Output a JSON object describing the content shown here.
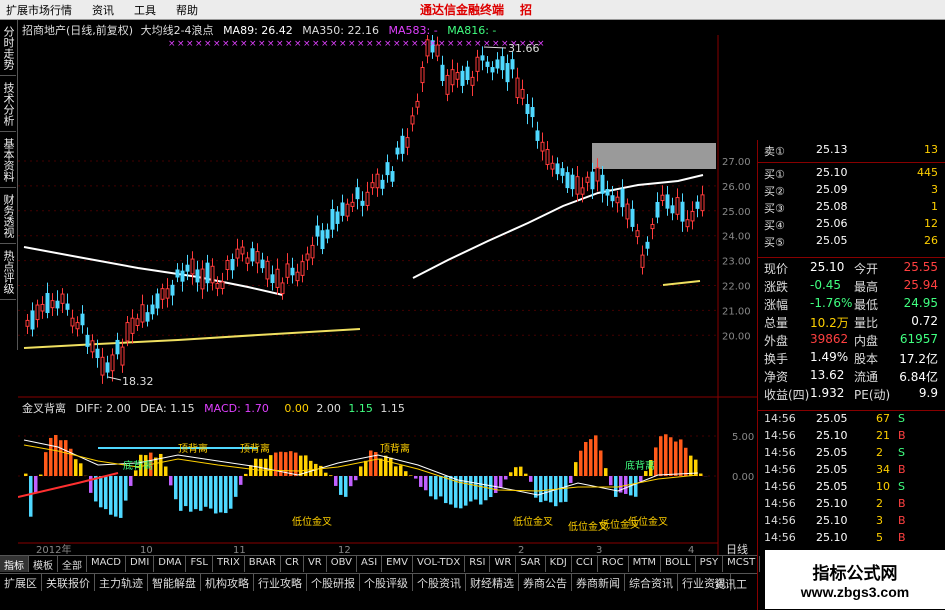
{
  "menu": {
    "items": [
      "扩展市场行情",
      "资讯",
      "工具",
      "帮助"
    ],
    "promo": "通达信金融终端",
    "promo2": "招"
  },
  "left_tabs": [
    "分时走势",
    "技术分析",
    "基本资料",
    "财务透视",
    "热点评级"
  ],
  "chart_title": {
    "name": "招商地产(日线,前复权)",
    "indicator": "大均线2-4浪点",
    "ma89": "MA89: 26.42",
    "ma350": "MA350: 22.16",
    "ma583": "MA583: -",
    "ma816": "MA816: -"
  },
  "price_labels": {
    "high": "31.66",
    "low": "18.32"
  },
  "price_axis": [
    "27.00",
    "26.00",
    "25.00",
    "24.00",
    "23.00",
    "22.00",
    "21.00",
    "20.00"
  ],
  "macd_title": {
    "name": "金叉背离",
    "diff": "DIFF: 2.00",
    "dea": "DEA: 1.15",
    "macd": "MACD: 1.70",
    "v1": "0.00",
    "v2": "2.00",
    "v3": "1.15",
    "v4": "1.15"
  },
  "macd_axis": [
    "5.00",
    "0.00"
  ],
  "annotations": [
    "顶背离",
    "顶背离",
    "顶背离",
    "低位金叉",
    "低位金叉",
    "低位金叉",
    "低位金叉",
    "低位金叉",
    "底背离",
    "底背离"
  ],
  "date_labels": [
    "2012年",
    "10",
    "11",
    "12",
    "2",
    "3",
    "4"
  ],
  "order_book": {
    "sells": [
      {
        "label": "卖①",
        "price": "25.13",
        "vol": "13"
      }
    ],
    "buys": [
      {
        "label": "买①",
        "price": "25.10",
        "vol": "445"
      },
      {
        "label": "买②",
        "price": "25.09",
        "vol": "3"
      },
      {
        "label": "买③",
        "price": "25.08",
        "vol": "1"
      },
      {
        "label": "买④",
        "price": "25.06",
        "vol": "12"
      },
      {
        "label": "买⑤",
        "price": "25.05",
        "vol": "26"
      }
    ]
  },
  "quote": [
    {
      "l": "现价",
      "v": "25.10",
      "l2": "今开",
      "v2": "25.55"
    },
    {
      "l": "涨跌",
      "v": "-0.45",
      "l2": "最高",
      "v2": "25.94"
    },
    {
      "l": "涨幅",
      "v": "-1.76%",
      "l2": "最低",
      "v2": "24.95"
    },
    {
      "l": "总量",
      "v": "10.2万",
      "l2": "量比",
      "v2": "0.72"
    },
    {
      "l": "外盘",
      "v": "39862",
      "l2": "内盘",
      "v2": "61957"
    },
    {
      "l": "换手",
      "v": "1.49%",
      "l2": "股本",
      "v2": "17.2亿"
    },
    {
      "l": "净资",
      "v": "13.62",
      "l2": "流通",
      "v2": "6.84亿"
    },
    {
      "l": "收益(四)",
      "v": "1.932",
      "l2": "PE(动)",
      "v2": "9.9"
    }
  ],
  "ticks": [
    {
      "t": "14:56",
      "p": "25.05",
      "v": "67",
      "s": "S"
    },
    {
      "t": "14:56",
      "p": "25.10",
      "v": "21",
      "s": "B"
    },
    {
      "t": "14:56",
      "p": "25.05",
      "v": "2",
      "s": "S"
    },
    {
      "t": "14:56",
      "p": "25.05",
      "v": "34",
      "s": "B"
    },
    {
      "t": "14:56",
      "p": "25.05",
      "v": "10",
      "s": "S"
    },
    {
      "t": "14:56",
      "p": "25.10",
      "v": "2",
      "s": "B"
    },
    {
      "t": "14:56",
      "p": "25.10",
      "v": "3",
      "s": "B"
    },
    {
      "t": "14:56",
      "p": "25.10",
      "v": "5",
      "s": "B"
    }
  ],
  "indicator_tabs": [
    "指标",
    "模板",
    "全部",
    "MACD",
    "DMI",
    "DMA",
    "FSL",
    "TRIX",
    "BRAR",
    "CR",
    "VR",
    "OBV",
    "ASI",
    "EMV",
    "VOL-TDX",
    "RSI",
    "WR",
    "SAR",
    "KDJ",
    "CCI",
    "ROC",
    "MTM",
    "BOLL",
    "PSY",
    "MCST"
  ],
  "bottom_tabs": [
    "扩展区",
    "关联报价",
    "主力轨迹",
    "智能解盘",
    "机构攻略",
    "行业攻略",
    "个股研报",
    "个股评级",
    "个股资讯",
    "财经精选",
    "券商公告",
    "券商新闻",
    "综合资讯",
    "行业资讯"
  ],
  "right_bottom": {
    "tab1": "日线",
    "tab2": "资讯工"
  },
  "watermark": {
    "line1": "指标公式网",
    "line2": "www.zbgs3.com"
  },
  "colors": {
    "up": "#ff3b3b",
    "down": "#4fd8ff",
    "ma_white": "#ffffff",
    "ma_yellow": "#f0e060",
    "macd_magenta": "#e040ff",
    "macd_yellow": "#ffd000"
  }
}
